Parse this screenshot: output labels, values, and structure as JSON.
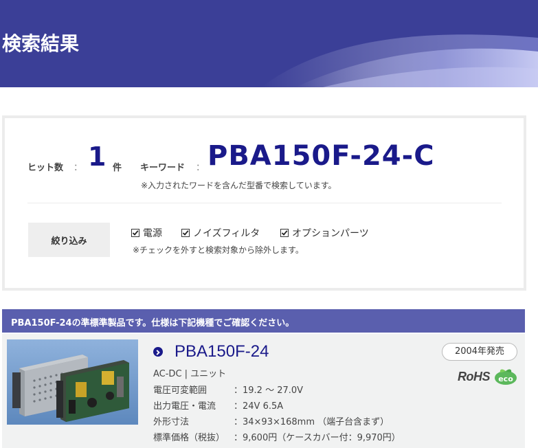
{
  "header": {
    "title": "検索結果"
  },
  "search_summary": {
    "hits_label": "ヒット数",
    "colon": "：",
    "hits_count": "1",
    "hits_unit": "件",
    "keyword_label": "キーワード",
    "keyword": "PBA150F-24-C",
    "keyword_note": "※入力されたワードを含んだ型番で検索しています。"
  },
  "filter": {
    "button_label": "絞り込み",
    "options": [
      {
        "label": "電源",
        "checked": true
      },
      {
        "label": "ノイズフィルタ",
        "checked": true
      },
      {
        "label": "オプションパーツ",
        "checked": true
      }
    ],
    "note": "※チェックを外すと検索対象から除外します。"
  },
  "result": {
    "banner": "PBA150F-24の準標準製品です。仕様は下記機種でご確認ください。",
    "product_name": "PBA150F-24",
    "category": "AC-DC | ユニット",
    "release": "2004年発売",
    "rohs": "RoHS",
    "eco_label": "eco",
    "specs": [
      {
        "key": "電圧可変範囲",
        "value": "：19.2 ～ 27.0V"
      },
      {
        "key": "出力電圧・電流",
        "value": "：24V 6.5A"
      },
      {
        "key": "外形寸法",
        "value": "：34×93×168mm （端子台含まず）"
      },
      {
        "key": "標準価格（税抜）",
        "value": "：9,600円（ケースカバー付：9,970円）"
      }
    ]
  },
  "colors": {
    "header_bg": "#3b3f97",
    "accent_navy": "#1a1a8a",
    "banner_bg": "#5a5fae",
    "row_bg": "#f1f2f2"
  }
}
